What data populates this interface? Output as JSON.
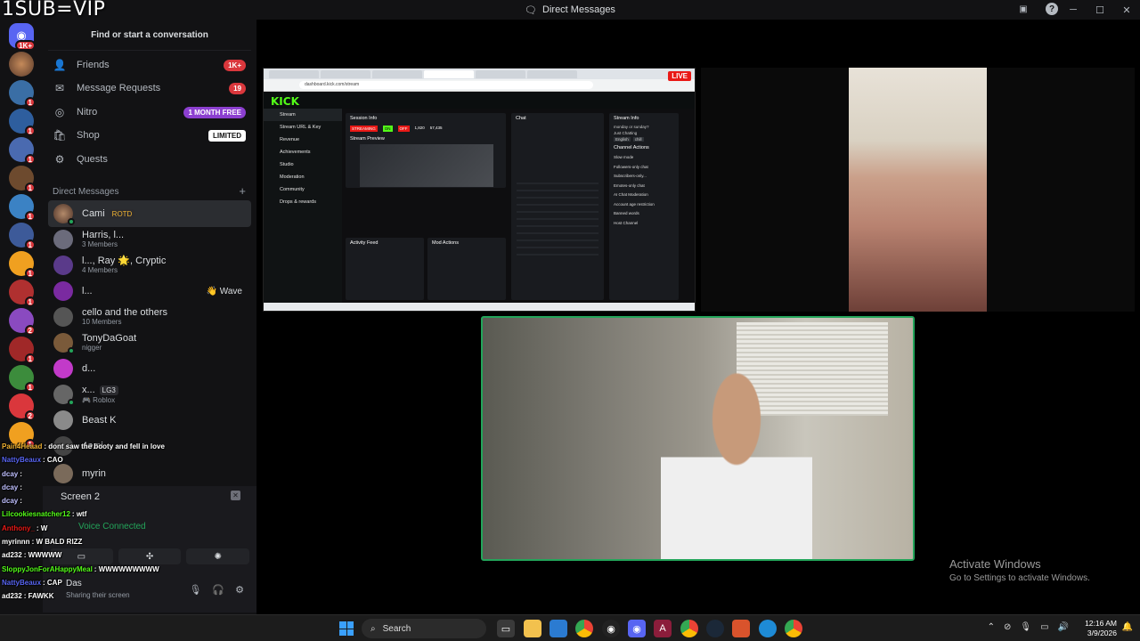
{
  "overlay_title": "1SUB=VIP",
  "window": {
    "title": "Direct Messages"
  },
  "sidebar": {
    "find_placeholder": "Find or start a conversation",
    "nav": [
      {
        "label": "Friends",
        "icon": "friends-icon",
        "badge": "1K+"
      },
      {
        "label": "Message Requests",
        "icon": "envelope-icon",
        "badge": "19"
      },
      {
        "label": "Nitro",
        "icon": "nitro-icon",
        "badge": "1 MONTH FREE"
      },
      {
        "label": "Shop",
        "icon": "shop-icon",
        "badge": "LIMITED"
      },
      {
        "label": "Quests",
        "icon": "quests-icon",
        "badge": ""
      }
    ],
    "dm_header": "Direct Messages",
    "dms": [
      {
        "name": "Cami",
        "tag": "ROTD",
        "sub": ""
      },
      {
        "name": "Harris, l...",
        "sub": "3 Members"
      },
      {
        "name": "l..., Ray 🌟, Cryptic",
        "sub": "4 Members"
      },
      {
        "name": "l...",
        "sub": "",
        "wave": "👋 Wave"
      },
      {
        "name": "cello and the others",
        "sub": "10 Members"
      },
      {
        "name": "TonyDaGoat",
        "sub": "nigger"
      },
      {
        "name": "d...",
        "sub": ""
      },
      {
        "name": "x...",
        "tag": "LG3",
        "sub": "🎮 Roblox"
      },
      {
        "name": "Beast K",
        "sub": ""
      },
      {
        "name": "4omi",
        "sub": ""
      },
      {
        "name": "myrin",
        "sub": ""
      }
    ]
  },
  "rail_badges": [
    "1K+",
    "1",
    "1",
    "1",
    "1",
    "1",
    "1",
    "1",
    "1",
    "2",
    "1",
    "1",
    "2",
    "1",
    "1",
    "1"
  ],
  "voice": {
    "title": "Screen 2",
    "status": "Voice Connected",
    "user": "Das",
    "user_sub": "Sharing their screen"
  },
  "chat": [
    {
      "user": "Pain4Heaad",
      "msg": "dont saw the booty and fell in love",
      "color": "#f0b232"
    },
    {
      "user": "NattyBeaux",
      "msg": "CAO",
      "color": "#5865f2"
    },
    {
      "user": "dcay",
      "msg": "",
      "color": "#c0c0ff"
    },
    {
      "user": "dcay",
      "msg": "",
      "color": "#c0c0ff"
    },
    {
      "user": "dcay",
      "msg": "",
      "color": "#c0c0ff"
    },
    {
      "user": "Lilcookiesnatcher12",
      "msg": "wtf",
      "color": "#53fc18"
    },
    {
      "user": "Anthony_",
      "msg": "W",
      "color": "#e91916"
    },
    {
      "user": "myrinnn",
      "msg": "W BALD RIZZ",
      "color": "#ffffff"
    },
    {
      "user": "ad232",
      "msg": "WWWWW",
      "color": "#ffffff"
    },
    {
      "user": "SloppyJonForAHappyMeal",
      "msg": "WWWWWWWWW",
      "color": "#53fc18"
    },
    {
      "user": "NattyBeaux",
      "msg": "CAP",
      "color": "#5865f2"
    },
    {
      "user": "ad232",
      "msg": "FAWKK",
      "color": "#ffffff"
    }
  ],
  "kick": {
    "live_label": "LIVE",
    "logo": "KICK",
    "url": "dashboard.kick.com/stream",
    "nav": [
      "Stream",
      "Stream URL & Key",
      "Revenue",
      "Achievements",
      "Studio",
      "Moderation",
      "Community",
      "Drops & rewards"
    ],
    "panels": {
      "session": "Session Info",
      "chat": "Chat",
      "stream_info": "Stream Info",
      "preview": "Stream Preview",
      "activity": "Activity Feed",
      "mod": "Mod Actions",
      "channel_actions": "Channel Actions"
    },
    "stats": [
      "STREAMING",
      "ON",
      "OFF",
      "1,820",
      "57,435"
    ],
    "channel_actions": [
      "Slow mode",
      "Followers-only chat",
      "Subscribers-only...",
      "Emotes-only chat",
      "AI Chat Moderation",
      "Account age restriction",
      "Banned words",
      "Host Channel"
    ],
    "stream_title": "monday or sunday?",
    "category": "Just Chatting",
    "tags": [
      "English",
      "chill"
    ]
  },
  "watermark": {
    "title": "Activate Windows",
    "subtitle": "Go to Settings to activate Windows."
  },
  "taskbar": {
    "search": "Search",
    "time": "12:16 AM",
    "date": "3/9/2026"
  },
  "colors": {
    "accent": "#5865f2",
    "green": "#23a55a",
    "kick_green": "#53fc18",
    "red": "#da373c"
  }
}
